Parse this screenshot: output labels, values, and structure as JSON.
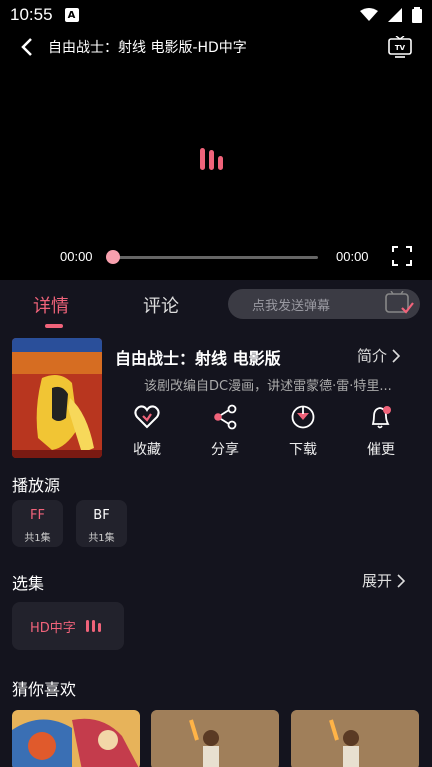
{
  "status_bar": {
    "time": "10:55",
    "notification_icon": "A"
  },
  "video": {
    "title": "自由战士：射线 电影版-HD中字",
    "time_current": "00:00",
    "time_total": "00:00",
    "progress": 0
  },
  "tabs": {
    "detail": "详情",
    "comment": "评论"
  },
  "danmaku": {
    "placeholder": "点我发送弹幕"
  },
  "movie": {
    "title": "自由战士：射线 电影版",
    "intro_label": "简介",
    "synopsis": "该剧改编自DC漫画，讲述雷蒙德·雷·特里..."
  },
  "actions": [
    {
      "label": "收藏",
      "icon": "heart-icon"
    },
    {
      "label": "分享",
      "icon": "share-icon"
    },
    {
      "label": "下载",
      "icon": "download-icon"
    },
    {
      "label": "催更",
      "icon": "bell-icon"
    }
  ],
  "sources": {
    "heading": "播放源",
    "items": [
      {
        "name": "FF",
        "count": "共1集"
      },
      {
        "name": "BF",
        "count": "共1集"
      }
    ]
  },
  "episodes": {
    "heading": "选集",
    "expand_label": "展开",
    "items": [
      {
        "label": "HD中字"
      }
    ]
  },
  "recommend": {
    "heading": "猜你喜欢"
  },
  "colors": {
    "accent": "#f0637a",
    "background": "#14141e",
    "card": "#22222c"
  }
}
